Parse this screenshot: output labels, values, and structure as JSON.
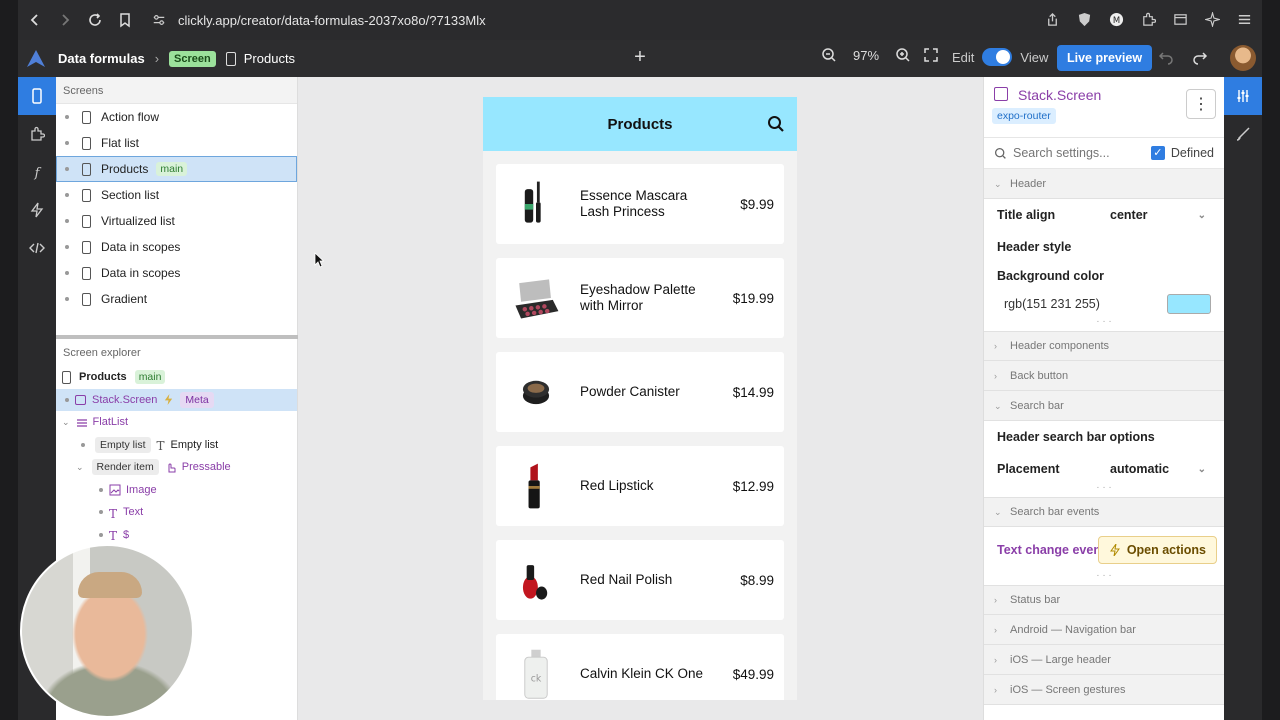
{
  "browser": {
    "url": "clickly.app/creator/data-formulas-2037xo8o/?7133Mlx"
  },
  "app": {
    "title": "Data formulas",
    "screen_badge": "Screen",
    "current_screen": "Products",
    "zoom": "97%",
    "edit_label": "Edit",
    "view_label": "View",
    "live_preview": "Live preview"
  },
  "screens": {
    "header": "Screens",
    "items": [
      {
        "label": "Action flow"
      },
      {
        "label": "Flat list"
      },
      {
        "label": "Products",
        "tag": "main"
      },
      {
        "label": "Section list"
      },
      {
        "label": "Virtualized list"
      },
      {
        "label": "Data in scopes"
      },
      {
        "label": "Data in scopes"
      },
      {
        "label": "Gradient"
      }
    ]
  },
  "explorer": {
    "header": "Screen explorer",
    "root": "Products",
    "root_tag": "main",
    "stack": "Stack.Screen",
    "stack_tag": "Meta",
    "flatlist": "FlatList",
    "empty_chip": "Empty list",
    "empty_text": "Empty list",
    "render_chip": "Render item",
    "pressable": "Pressable",
    "image": "Image",
    "text": "Text",
    "dollar": "$"
  },
  "phone": {
    "header_title": "Products",
    "products": [
      {
        "name": "Essence Mascara Lash Princess",
        "price": "$9.99"
      },
      {
        "name": "Eyeshadow Palette with Mirror",
        "price": "$19.99"
      },
      {
        "name": "Powder Canister",
        "price": "$14.99"
      },
      {
        "name": "Red Lipstick",
        "price": "$12.99"
      },
      {
        "name": "Red Nail Polish",
        "price": "$8.99"
      },
      {
        "name": "Calvin Klein CK One",
        "price": "$49.99"
      }
    ]
  },
  "settings": {
    "title": "Stack.Screen",
    "chip": "expo-router",
    "search_placeholder": "Search settings...",
    "defined_label": "Defined",
    "sections": {
      "header": "Header",
      "header_components": "Header components",
      "back_button": "Back button",
      "search_bar": "Search bar",
      "search_bar_events": "Search bar events",
      "status_bar": "Status bar",
      "android_nav": "Android — Navigation bar",
      "ios_large_header": "iOS — Large header",
      "ios_gestures": "iOS — Screen gestures"
    },
    "title_align_label": "Title align",
    "title_align_value": "center",
    "header_style_label": "Header style",
    "bg_color_label": "Background color",
    "bg_color_value": "rgb(151  231  255)",
    "bg_color_hex": "#97e7ff",
    "search_options_label": "Header search bar options",
    "placement_label": "Placement",
    "placement_value": "automatic",
    "text_change_label": "Text change event",
    "open_actions": "Open actions"
  }
}
